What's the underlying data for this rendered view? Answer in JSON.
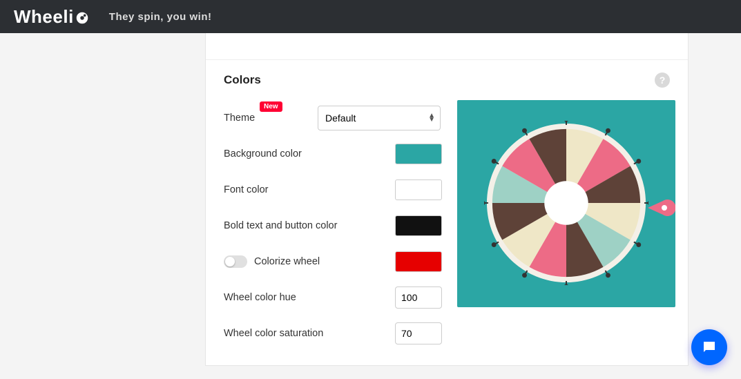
{
  "header": {
    "brand": "Wheeli",
    "tagline": "They spin, you win!"
  },
  "section": {
    "title": "Colors"
  },
  "form": {
    "theme": {
      "label": "Theme",
      "badge": "New",
      "selected": "Default"
    },
    "background": {
      "label": "Background color",
      "value": "#2ba6a4"
    },
    "font": {
      "label": "Font color",
      "value": "#ffffff"
    },
    "bold": {
      "label": "Bold text and button color",
      "value": "#111111"
    },
    "colorize": {
      "label": "Colorize wheel",
      "value": "#e60000",
      "enabled": false
    },
    "hue": {
      "label": "Wheel color hue",
      "value": "100"
    },
    "saturation": {
      "label": "Wheel color saturation",
      "value": "70"
    }
  },
  "wheel": {
    "slices": [
      "#efe7c7",
      "#ed6b86",
      "#5e4238",
      "#efe7c7",
      "#9ed1c5",
      "#5e4238",
      "#ed6b86",
      "#efe7c7",
      "#5e4238",
      "#9ed1c5",
      "#ed6b86",
      "#5e4238"
    ],
    "pointer": "#ed6b86",
    "rim": "#f4f0e8",
    "hub": "#ffffff"
  }
}
